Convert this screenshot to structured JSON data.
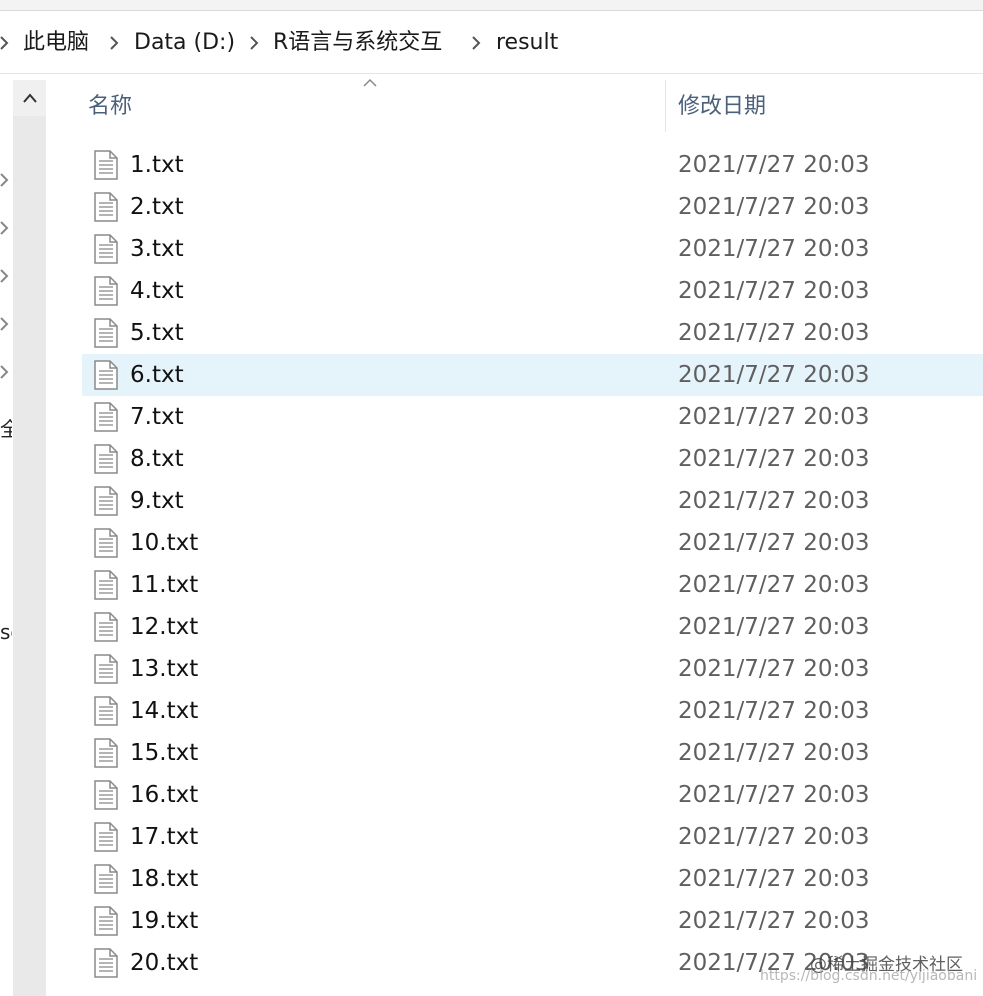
{
  "breadcrumb": {
    "items": [
      {
        "label": "此电脑"
      },
      {
        "label": "Data (D:)"
      },
      {
        "label": "R语言与系统交互"
      },
      {
        "label": "result"
      }
    ]
  },
  "nav_pane": {
    "fragments": [
      "全部",
      "sc"
    ]
  },
  "columns": {
    "name": "名称",
    "modified": "修改日期"
  },
  "files": [
    {
      "name": "1.txt",
      "modified": "2021/7/27 20:03",
      "selected": false
    },
    {
      "name": "2.txt",
      "modified": "2021/7/27 20:03",
      "selected": false
    },
    {
      "name": "3.txt",
      "modified": "2021/7/27 20:03",
      "selected": false
    },
    {
      "name": "4.txt",
      "modified": "2021/7/27 20:03",
      "selected": false
    },
    {
      "name": "5.txt",
      "modified": "2021/7/27 20:03",
      "selected": false
    },
    {
      "name": "6.txt",
      "modified": "2021/7/27 20:03",
      "selected": true
    },
    {
      "name": "7.txt",
      "modified": "2021/7/27 20:03",
      "selected": false
    },
    {
      "name": "8.txt",
      "modified": "2021/7/27 20:03",
      "selected": false
    },
    {
      "name": "9.txt",
      "modified": "2021/7/27 20:03",
      "selected": false
    },
    {
      "name": "10.txt",
      "modified": "2021/7/27 20:03",
      "selected": false
    },
    {
      "name": "11.txt",
      "modified": "2021/7/27 20:03",
      "selected": false
    },
    {
      "name": "12.txt",
      "modified": "2021/7/27 20:03",
      "selected": false
    },
    {
      "name": "13.txt",
      "modified": "2021/7/27 20:03",
      "selected": false
    },
    {
      "name": "14.txt",
      "modified": "2021/7/27 20:03",
      "selected": false
    },
    {
      "name": "15.txt",
      "modified": "2021/7/27 20:03",
      "selected": false
    },
    {
      "name": "16.txt",
      "modified": "2021/7/27 20:03",
      "selected": false
    },
    {
      "name": "17.txt",
      "modified": "2021/7/27 20:03",
      "selected": false
    },
    {
      "name": "18.txt",
      "modified": "2021/7/27 20:03",
      "selected": false
    },
    {
      "name": "19.txt",
      "modified": "2021/7/27 20:03",
      "selected": false
    },
    {
      "name": "20.txt",
      "modified": "2021/7/27 20:03",
      "selected": false
    }
  ],
  "watermark": {
    "text": "@稀土掘金技术社区",
    "url": "https://blog.csdn.net/yijiaobani"
  },
  "colors": {
    "selected_row": "#e5f3fb",
    "header_text": "#4c607a",
    "date_text": "#5f5f5f"
  }
}
